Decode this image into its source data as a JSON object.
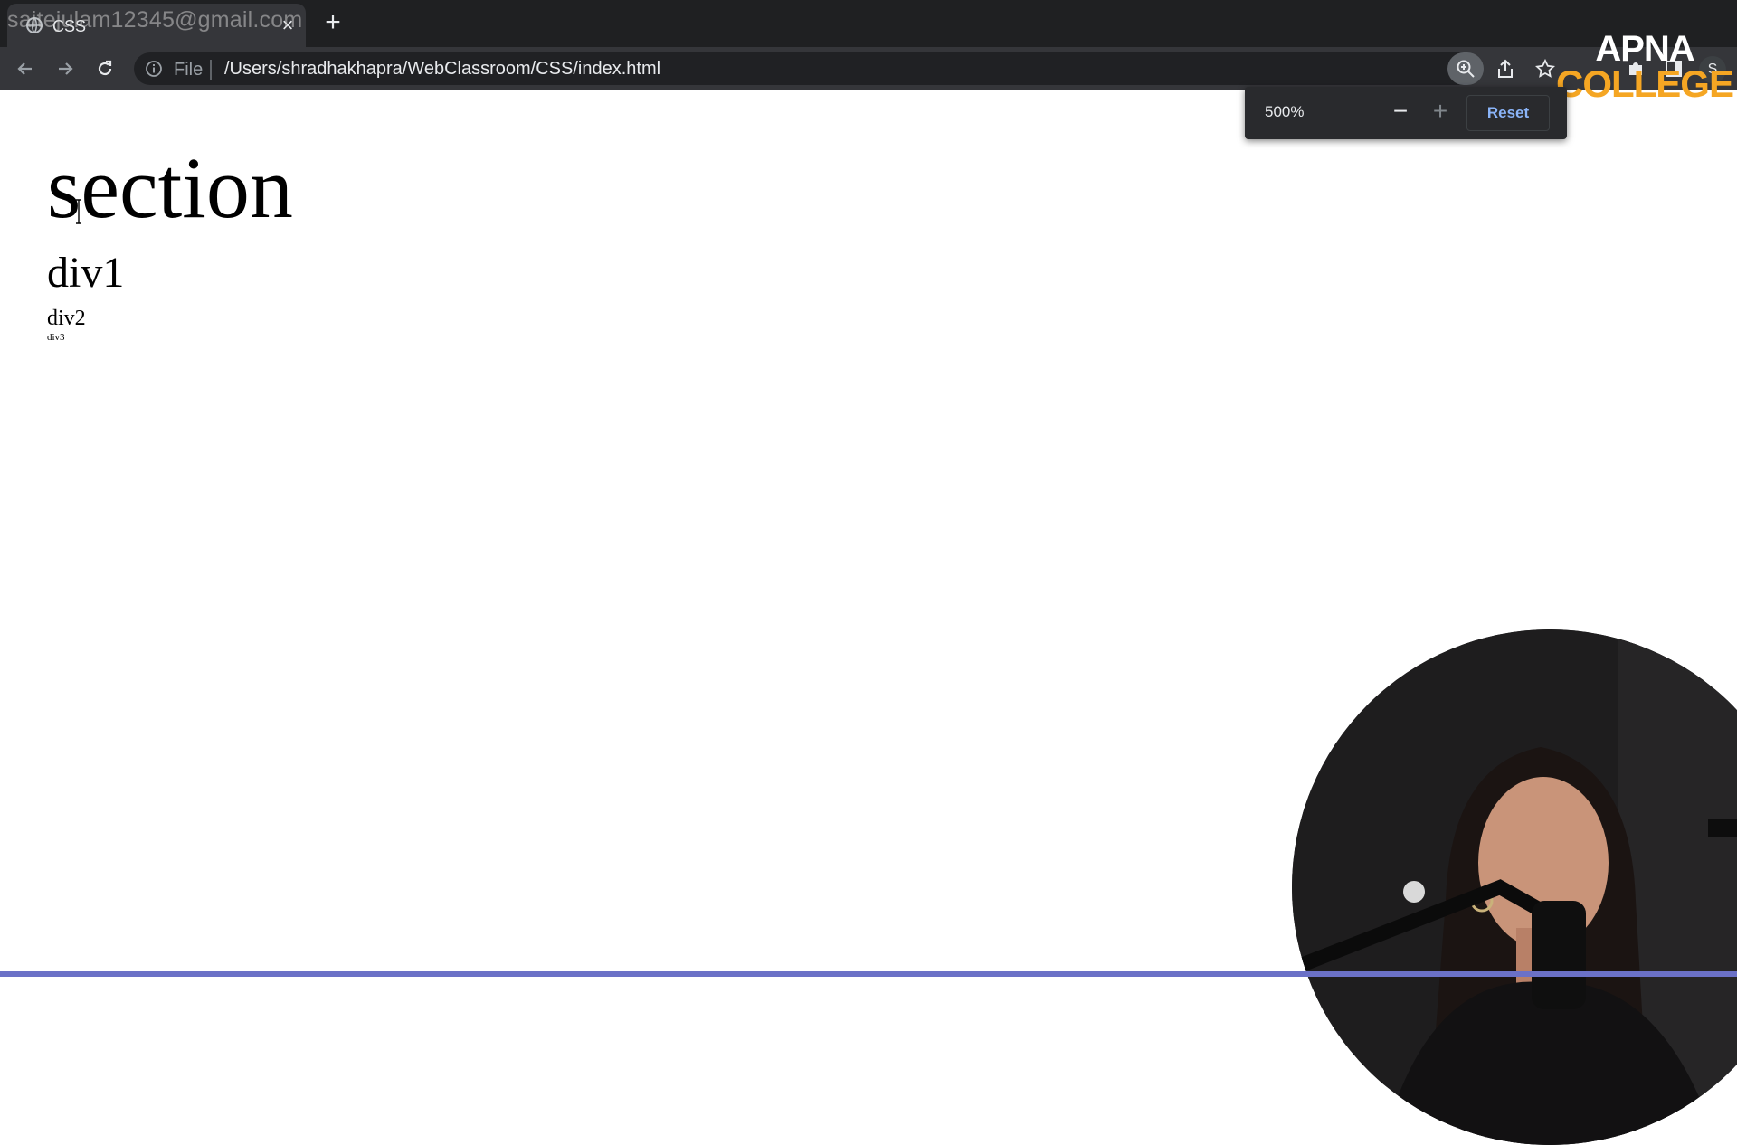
{
  "browser": {
    "tab": {
      "title": "CSS",
      "favicon": "globe-icon"
    },
    "watermark_email": "saitejulam12345@gmail.com",
    "toolbar": {
      "scheme_label": "File",
      "url": "/Users/shradhakhapra/WebClassroom/CSS/index.html",
      "profile_initial": "S"
    },
    "zoom_popup": {
      "level": "500%",
      "minus": "−",
      "plus": "+",
      "reset_label": "Reset"
    }
  },
  "brand": {
    "line1": "APNA",
    "line2": "COLLEGE",
    "colors": {
      "line1": "#ffffff",
      "line2": "#f5a623"
    }
  },
  "page": {
    "section_text": "section",
    "div1_text": "div1",
    "div2_text": "div2",
    "div3_text": "div3"
  },
  "colors": {
    "tabstrip_bg": "#1f2022",
    "toolbar_bg": "#35363a",
    "accent_link": "#8ab4f8",
    "progress_bar": "#6b71c7"
  }
}
